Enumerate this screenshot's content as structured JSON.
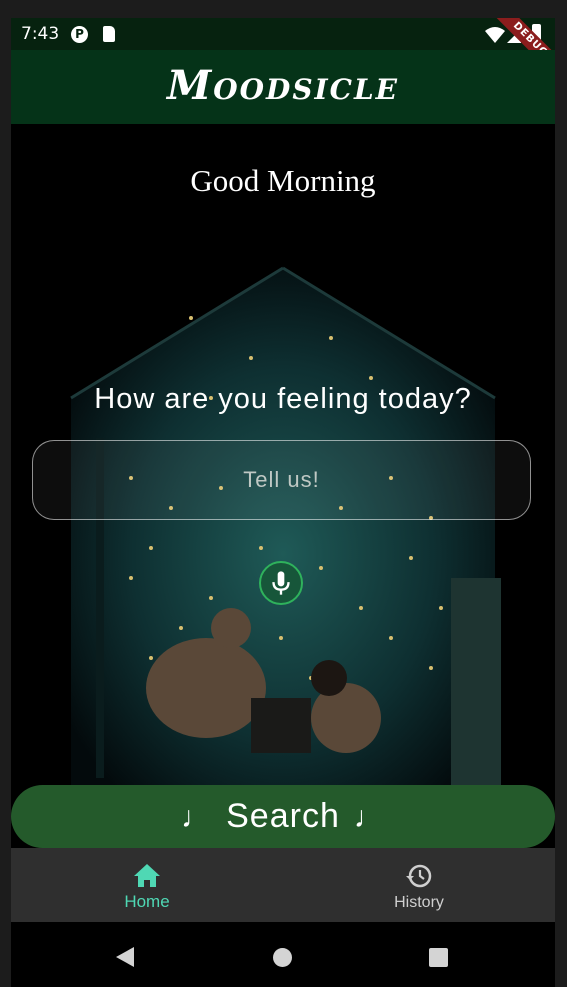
{
  "status_bar": {
    "time": "7:43",
    "icons": [
      "p-app-icon",
      "sd-card-icon",
      "wifi-icon",
      "signal-icon",
      "battery-icon"
    ],
    "debug_label": "DEBUG"
  },
  "app_bar": {
    "title": "Moodsicle"
  },
  "greeting": "Good Morning",
  "question": "How are you feeling today?",
  "mood_input": {
    "placeholder": "Tell us!",
    "value": ""
  },
  "mic_icon": "microphone-icon",
  "search_button": {
    "label": "Search",
    "icon": "music-note-icon"
  },
  "bottom_nav": {
    "items": [
      {
        "label": "Home",
        "icon": "home-icon",
        "active": true
      },
      {
        "label": "History",
        "icon": "history-icon",
        "active": false
      }
    ]
  },
  "colors": {
    "app_bar": "#053318",
    "search_button": "#245a2b",
    "active_nav": "#4fd8b4",
    "mic_ring": "#2fb25c"
  }
}
